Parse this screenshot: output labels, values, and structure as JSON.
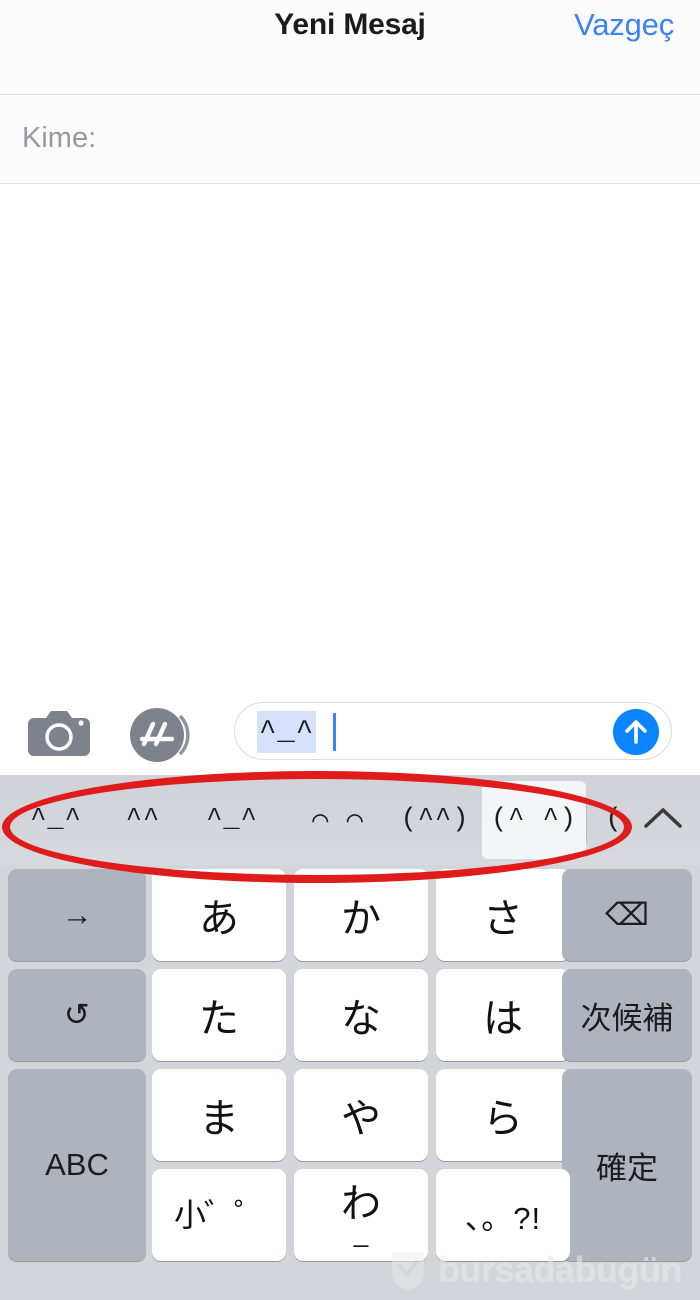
{
  "navbar": {
    "title": "Yeni Mesaj",
    "cancel_label": "Vazgeç"
  },
  "recipient": {
    "label": "Kime:"
  },
  "input_bar": {
    "camera_icon": "camera-icon",
    "appstore_icon": "app-store-icon",
    "text_value": "^_^",
    "send_icon": "send-arrow-up-icon"
  },
  "suggestions": {
    "items": [
      {
        "label": "^_^",
        "selected": false
      },
      {
        "label": "^^",
        "selected": false
      },
      {
        "label": "^_^",
        "selected": false
      },
      {
        "label": "⌒ ⌒",
        "selected": false
      },
      {
        "label": "(^^)",
        "selected": false
      },
      {
        "label": "(^ ^)",
        "selected": true
      },
      {
        "label": "(",
        "selected": false
      }
    ],
    "expand_icon": "chevron-up-icon"
  },
  "keyboard": {
    "rows": [
      {
        "left": {
          "label": "→",
          "name": "cursor-right-key",
          "style": "dark"
        },
        "keys": [
          {
            "label": "あ",
            "name": "kana-key-a"
          },
          {
            "label": "か",
            "name": "kana-key-ka"
          },
          {
            "label": "さ",
            "name": "kana-key-sa"
          }
        ],
        "right": {
          "label": "⌫",
          "name": "delete-key",
          "style": "dark"
        }
      },
      {
        "left": {
          "label": "↺",
          "name": "undo-key",
          "style": "dark"
        },
        "keys": [
          {
            "label": "た",
            "name": "kana-key-ta"
          },
          {
            "label": "な",
            "name": "kana-key-na"
          },
          {
            "label": "は",
            "name": "kana-key-ha"
          }
        ],
        "right": {
          "label": "次候補",
          "name": "next-candidate-key",
          "style": "dark"
        }
      },
      {
        "left": {
          "label": "ABC",
          "name": "abc-keyboard-switch-key",
          "style": "dark"
        },
        "keys": [
          {
            "label": "ま",
            "name": "kana-key-ma"
          },
          {
            "label": "や",
            "name": "kana-key-ya"
          },
          {
            "label": "ら",
            "name": "kana-key-ra"
          }
        ],
        "right": {
          "label": "確定",
          "name": "confirm-key",
          "style": "dark"
        }
      },
      {
        "left": null,
        "keys": [
          {
            "label": "小゛゜",
            "name": "small-dakuten-key"
          },
          {
            "label": "わ",
            "sub": "_",
            "name": "kana-key-wa"
          },
          {
            "label": "、。?!",
            "name": "punctuation-key"
          }
        ],
        "right": null
      }
    ]
  },
  "watermark": {
    "text": "bursadabugün"
  },
  "colors": {
    "accent_blue": "#3b82f7",
    "send_blue": "#0b84ff",
    "annotation_red": "#e01b1b",
    "keyboard_bg": "#d2d5da",
    "key_dark": "#aeb3bd",
    "key_light": "#ffffff",
    "placeholder_gray": "#9a9a9e"
  }
}
